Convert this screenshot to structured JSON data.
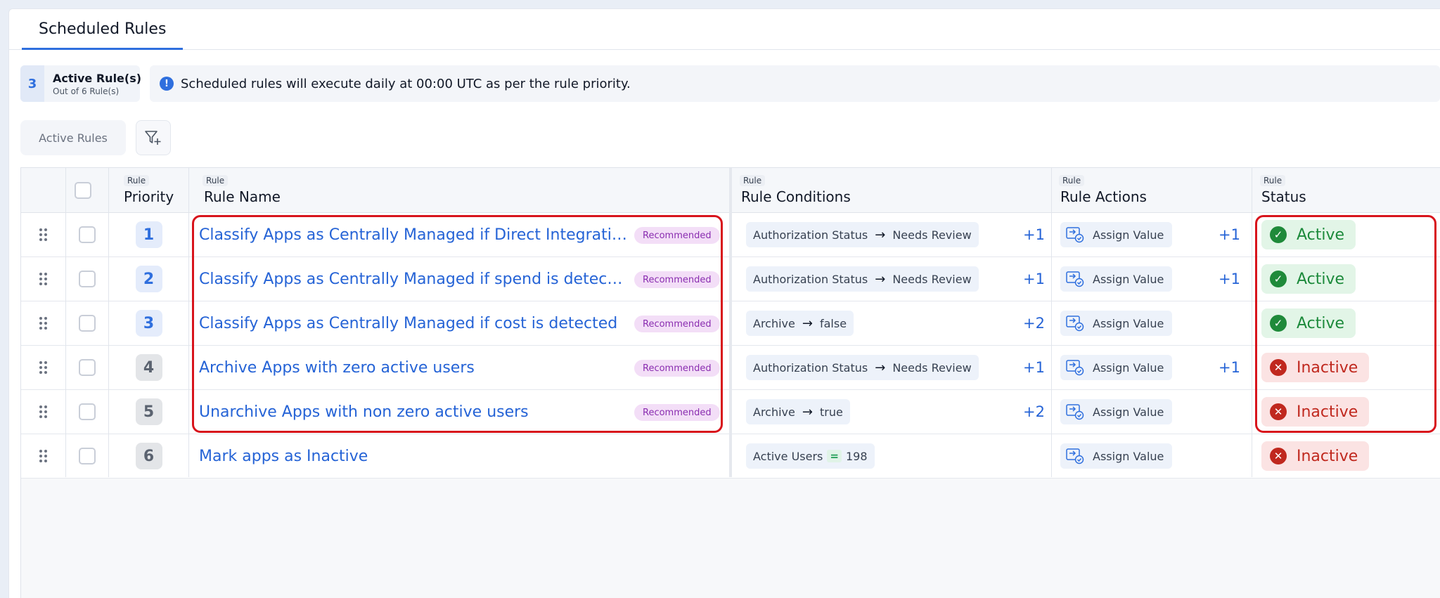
{
  "tabs": [
    {
      "label": "Scheduled Rules",
      "active": true
    }
  ],
  "summary": {
    "active_count": "3",
    "title": "Active Rule(s)",
    "subtitle": "Out of 6 Rule(s)",
    "info_icon": "info-icon",
    "info_text": "Scheduled rules will execute daily at 00:00 UTC as per the rule priority."
  },
  "filters": {
    "chip_label": "Active Rules",
    "add_filter_icon": "filter-plus-icon"
  },
  "table": {
    "columns": [
      {
        "small": "Rule",
        "label": "Priority"
      },
      {
        "small": "Rule",
        "label": "Rule Name"
      },
      {
        "small": "Rule",
        "label": "Rule Conditions"
      },
      {
        "small": "Rule",
        "label": "Rule Actions"
      },
      {
        "small": "Rule",
        "label": "Status"
      }
    ],
    "rows": [
      {
        "priority": "1",
        "name": "Classify Apps as Centrally Managed if Direct Integration is connected",
        "badge": "Recommended",
        "condition": {
          "field": "Authorization Status",
          "op": "→",
          "value": "Needs Review",
          "more": "+1"
        },
        "action": {
          "label": "Assign Value",
          "more": "+1"
        },
        "status": "Active"
      },
      {
        "priority": "2",
        "name": "Classify Apps as Centrally Managed if spend is detected",
        "badge": "Recommended",
        "condition": {
          "field": "Authorization Status",
          "op": "→",
          "value": "Needs Review",
          "more": "+1"
        },
        "action": {
          "label": "Assign Value",
          "more": "+1"
        },
        "status": "Active"
      },
      {
        "priority": "3",
        "name": "Classify Apps as Centrally Managed if cost is detected",
        "badge": "Recommended",
        "condition": {
          "field": "Archive",
          "op": "→",
          "value": "false",
          "more": "+2"
        },
        "action": {
          "label": "Assign Value",
          "more": ""
        },
        "status": "Active"
      },
      {
        "priority": "4",
        "name": "Archive Apps with zero active users",
        "badge": "Recommended",
        "condition": {
          "field": "Authorization Status",
          "op": "→",
          "value": "Needs Review",
          "more": "+1"
        },
        "action": {
          "label": "Assign Value",
          "more": "+1"
        },
        "status": "Inactive"
      },
      {
        "priority": "5",
        "name": "Unarchive Apps with non zero active users",
        "badge": "Recommended",
        "condition": {
          "field": "Archive",
          "op": "→",
          "value": "true",
          "more": "+2"
        },
        "action": {
          "label": "Assign Value",
          "more": ""
        },
        "status": "Inactive"
      },
      {
        "priority": "6",
        "name": "Mark apps as Inactive",
        "badge": "",
        "condition": {
          "field": "Active Users",
          "op": "=",
          "value": "198",
          "more": ""
        },
        "action": {
          "label": "Assign Value",
          "more": ""
        },
        "status": "Inactive"
      }
    ]
  },
  "colors": {
    "accent": "#2f6fde",
    "link": "#2563d6",
    "active": "#1f8a3a",
    "inactive": "#c0281e",
    "badge_bg": "#f3def7",
    "highlight": "#d8141c"
  }
}
